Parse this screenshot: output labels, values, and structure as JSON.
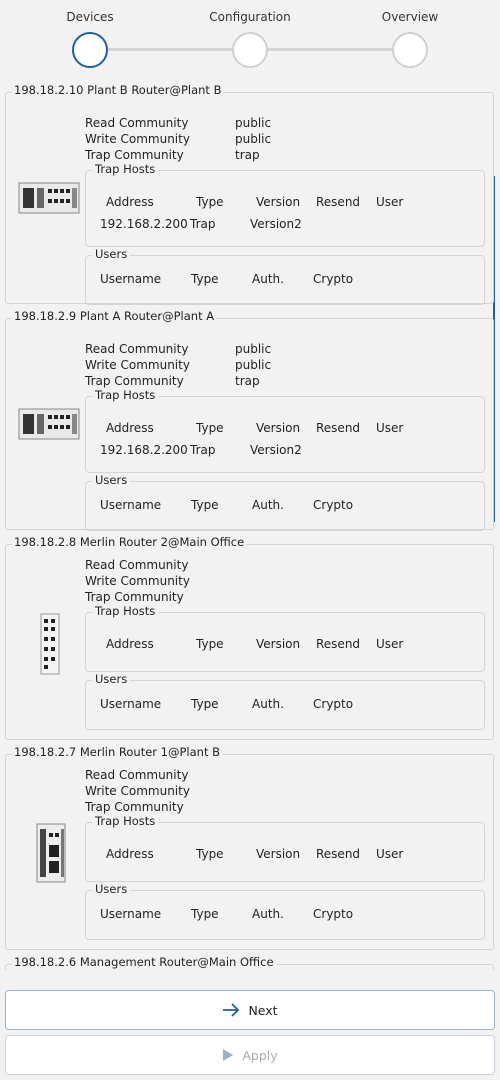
{
  "stepper": {
    "steps": [
      {
        "label": "Devices",
        "active": true
      },
      {
        "label": "Configuration",
        "active": false
      },
      {
        "label": "Overview",
        "active": false
      }
    ]
  },
  "labels": {
    "read_community": "Read Community",
    "write_community": "Write Community",
    "trap_community": "Trap Community",
    "trap_hosts": "Trap Hosts",
    "users": "Users",
    "address": "Address",
    "type": "Type",
    "version": "Version",
    "resend": "Resend",
    "user": "User",
    "username": "Username",
    "auth": "Auth.",
    "crypto": "Crypto"
  },
  "devices": [
    {
      "title": "198.18.2.10 Plant B Router@Plant B",
      "read": "public",
      "write": "public",
      "trap": "trap",
      "trap_hosts": [
        {
          "address": "192.168.2.200",
          "type": "Trap",
          "version": "Version2"
        }
      ]
    },
    {
      "title": "198.18.2.9 Plant A Router@Plant A",
      "read": "public",
      "write": "public",
      "trap": "trap",
      "trap_hosts": [
        {
          "address": "192.168.2.200",
          "type": "Trap",
          "version": "Version2"
        }
      ]
    },
    {
      "title": "198.18.2.8 Merlin Router 2@Main Office",
      "read": "",
      "write": "",
      "trap": "",
      "trap_hosts": []
    },
    {
      "title": "198.18.2.7 Merlin Router 1@Plant B",
      "read": "",
      "write": "",
      "trap": "",
      "trap_hosts": []
    },
    {
      "title": "198.18.2.6 Management Router@Main Office"
    }
  ],
  "buttons": {
    "next": "Next",
    "apply": "Apply"
  },
  "colors": {
    "accent": "#1f5fa3",
    "border": "#d4d4d4",
    "background": "#f2f2f2"
  }
}
